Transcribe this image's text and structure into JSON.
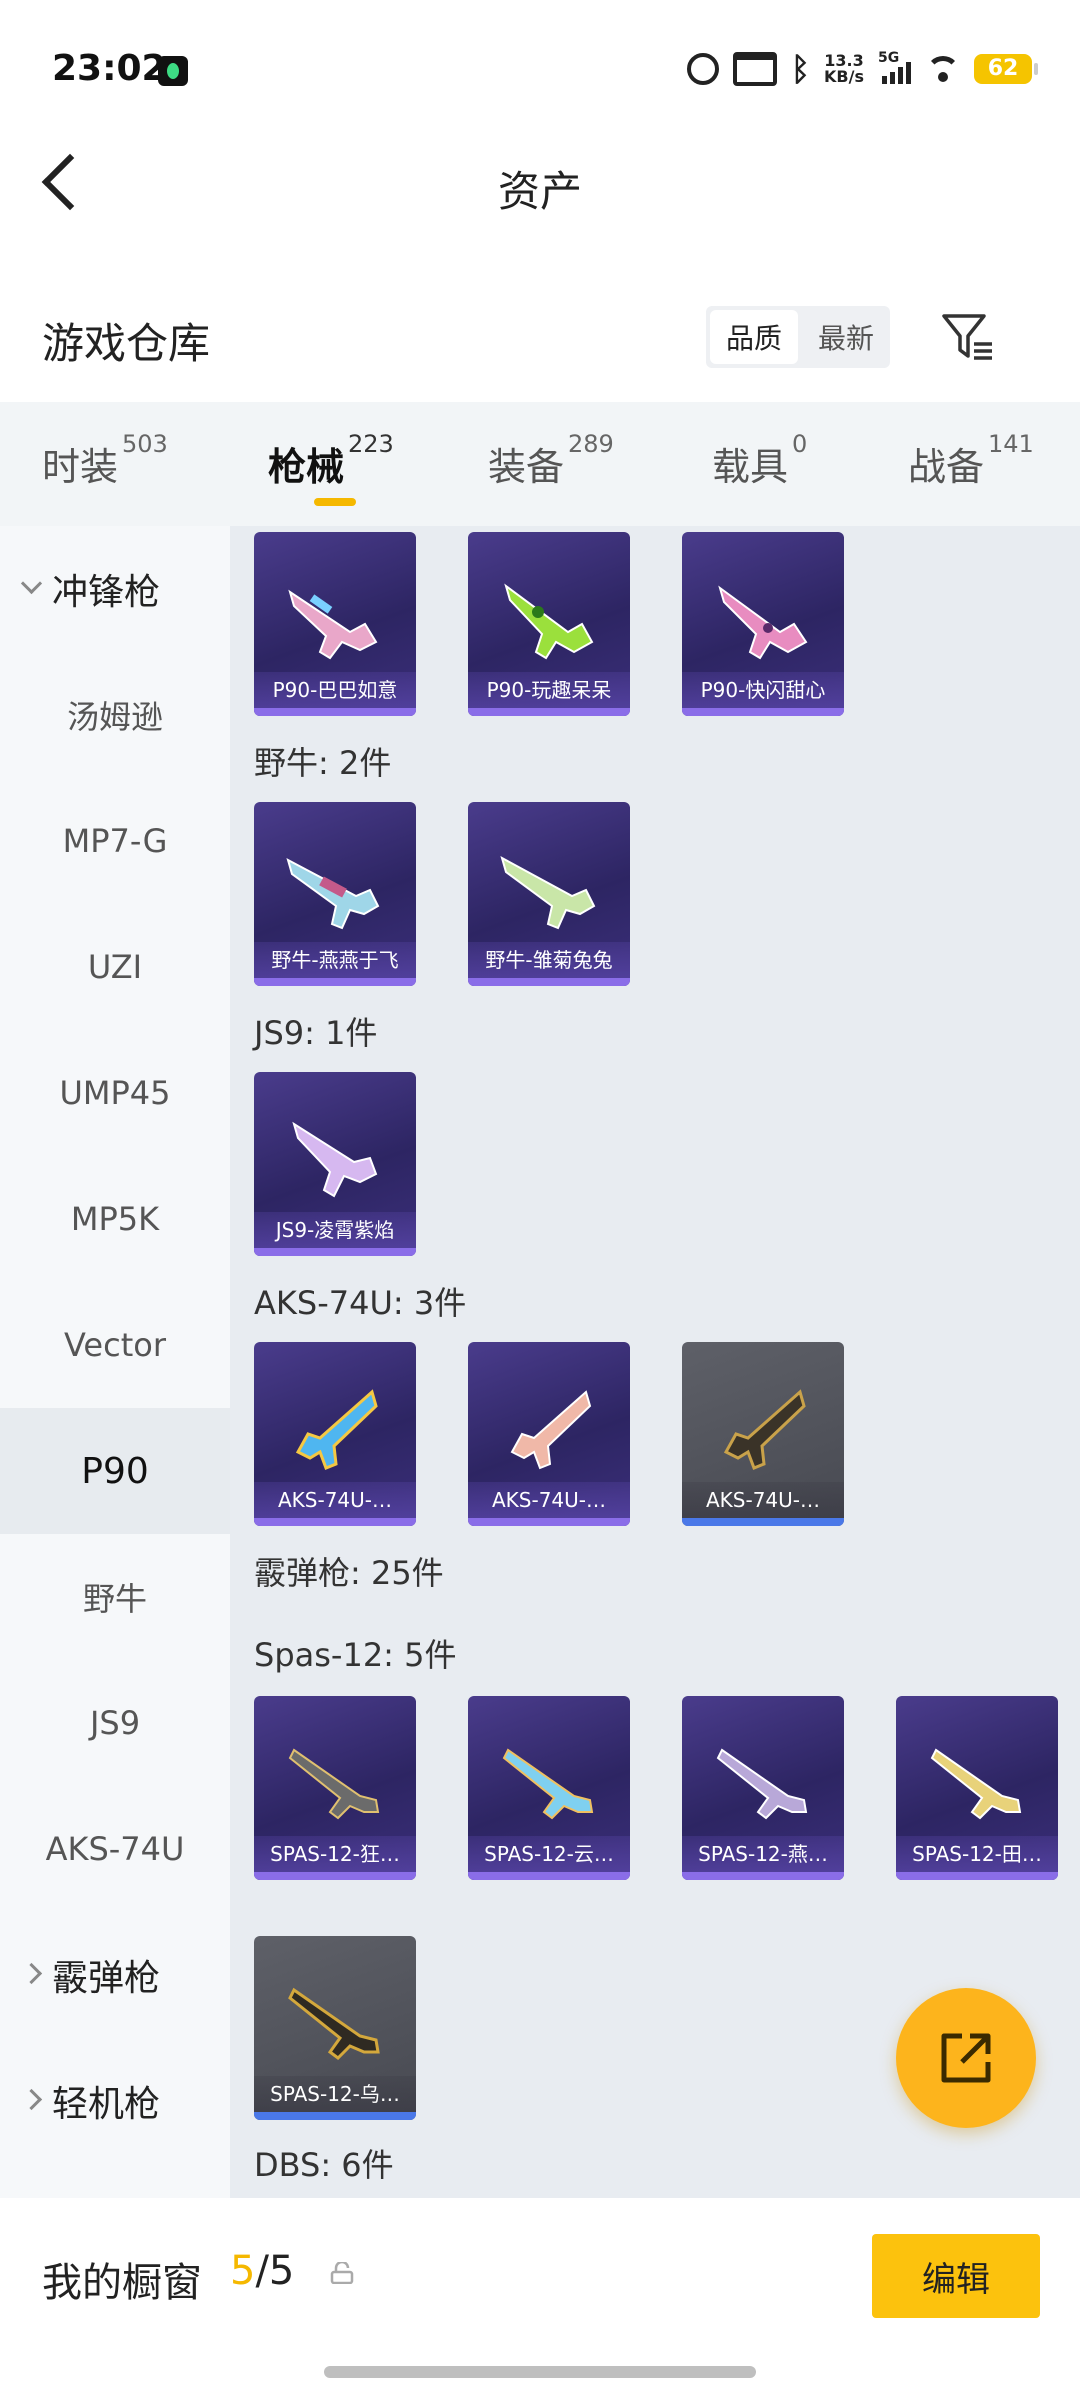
{
  "status_bar": {
    "time": "23:02",
    "net_speed_top": "13.3",
    "net_speed_bottom": "KB/s",
    "network": "5G",
    "battery": "62"
  },
  "header": {
    "title": "资产"
  },
  "warehouse": {
    "title": "游戏仓库",
    "sort_quality": "品质",
    "sort_newest": "最新"
  },
  "category_tabs": [
    {
      "label": "时装",
      "count": "503"
    },
    {
      "label": "枪械",
      "count": "223"
    },
    {
      "label": "装备",
      "count": "289"
    },
    {
      "label": "载具",
      "count": "0"
    },
    {
      "label": "战备",
      "count": "141"
    }
  ],
  "sidebar": {
    "items": [
      "冲锋枪",
      "汤姆逊",
      "MP7-G",
      "UZI",
      "UMP45",
      "MP5K",
      "Vector",
      "P90",
      "野牛",
      "JS9",
      "AKS-74U",
      "霰弹枪",
      "轻机枪"
    ],
    "selected": "P90"
  },
  "groups": {
    "p90": {
      "items": [
        "P90-巴巴如意",
        "P90-玩趣呆呆",
        "P90-快闪甜心"
      ]
    },
    "bizon": {
      "label": "野牛: 2件",
      "items": [
        "野牛-燕燕于飞",
        "野牛-雏菊兔兔"
      ]
    },
    "js9": {
      "label": "JS9: 1件",
      "items": [
        "JS9-凌霄紫焰"
      ]
    },
    "aks": {
      "label": "AKS-74U: 3件",
      "items": [
        "AKS-74U-…",
        "AKS-74U-…",
        "AKS-74U-…"
      ]
    },
    "shotgun": {
      "label": "霰弹枪: 25件"
    },
    "spas": {
      "label": "Spas-12: 5件",
      "items": [
        "SPAS-12-狂…",
        "SPAS-12-云…",
        "SPAS-12-燕…",
        "SPAS-12-田…",
        "SPAS-12-乌…"
      ]
    },
    "dbs": {
      "label": "DBS: 6件"
    }
  },
  "bottom": {
    "label": "我的橱窗",
    "count_current": "5",
    "count_sep_total": "/5",
    "edit": "编辑"
  },
  "colors": {
    "accent": "#fcc20d",
    "card_purple": "#2d2563",
    "card_grey": "#474951"
  },
  "icons": [
    "back-icon",
    "filter-icon",
    "share-icon",
    "lock-icon",
    "chevron-right-icon",
    "chevron-down-icon"
  ]
}
